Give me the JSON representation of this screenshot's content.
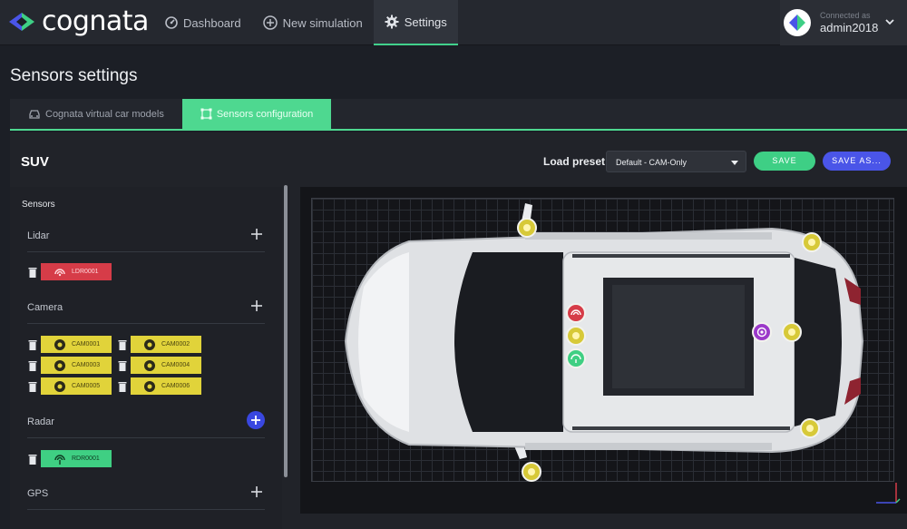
{
  "app": {
    "logo_text": "cognata",
    "nav": [
      {
        "label": "Dashboard",
        "icon": "dashboard-icon"
      },
      {
        "label": "New simulation",
        "icon": "plus-circle-icon"
      },
      {
        "label": "Settings",
        "icon": "gear-icon",
        "active": true
      }
    ],
    "user": {
      "caption": "Connected as",
      "name": "admin2018"
    }
  },
  "page": {
    "title": "Sensors settings"
  },
  "tabs": [
    {
      "label": "Cognata virtual car models",
      "icon": "car-icon",
      "active": false
    },
    {
      "label": "Sensors configuration",
      "icon": "frame-icon",
      "active": true
    }
  ],
  "vehicle": {
    "name": "SUV"
  },
  "preset": {
    "label": "Load preset",
    "selected": "Default - CAM-Only",
    "save_label": "SAVE",
    "save_as_label": "SAVE AS..."
  },
  "sensors": {
    "title": "Sensors",
    "sections": [
      {
        "label": "Lidar",
        "items": [
          "LDR0001"
        ]
      },
      {
        "label": "Camera",
        "items": [
          "CAM0001",
          "CAM0002",
          "CAM0003",
          "CAM0004",
          "CAM0005",
          "CAM0006"
        ]
      },
      {
        "label": "Radar",
        "items": [
          "RDR0001"
        ]
      },
      {
        "label": "GPS",
        "items": []
      }
    ]
  },
  "colors": {
    "accent": "#4ed890",
    "lidar": "#d63c48",
    "camera": "#e1d33a",
    "radar": "#3fcf83",
    "gps": "#9b39c9",
    "primary": "#4a55e8"
  }
}
